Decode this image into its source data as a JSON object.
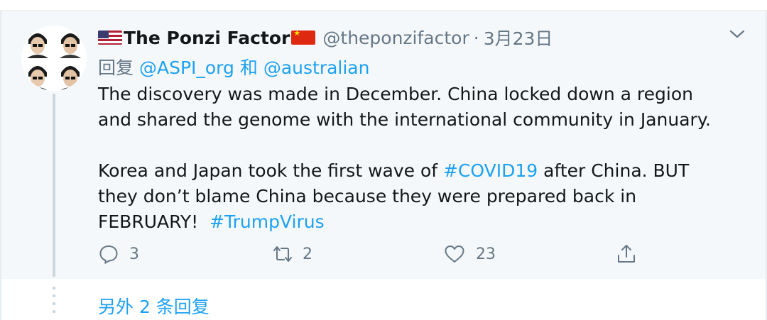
{
  "tweet": {
    "author_name": "The Ponzi Factor",
    "handle": "@theponzifactor",
    "separator": "·",
    "date": "3月23日",
    "reply_prefix": "回复",
    "reply_to_1": "@ASPI_org",
    "reply_joiner": "和",
    "reply_to_2": "@australian",
    "body_p1_line1": "The discovery was made in December. China locked down a region",
    "body_p1_line2": "and shared the genome with the international community in January.",
    "body_p2_line1_a": "Korea and Japan took the first wave of ",
    "body_p2_line1_hashtag": "#COVID19",
    "body_p2_line1_b": " after China. BUT",
    "body_p2_line2": "they don’t blame China because they were prepared back in",
    "body_p2_line3_a": "FEBRUARY!  ",
    "body_p2_line3_hashtag": "#TrumpVirus",
    "actions": {
      "reply_icon": "reply-icon",
      "reply_count": "3",
      "retweet_icon": "retweet-icon",
      "retweet_count": "2",
      "like_icon": "heart-icon",
      "like_count": "23",
      "share_icon": "share-icon"
    }
  },
  "more_replies": "另外 2 条回复",
  "colors": {
    "accent": "#1da1f2",
    "muted": "#657786",
    "tweet_bg": "#f5f8fa",
    "thread_line": "#ccd6dd"
  }
}
